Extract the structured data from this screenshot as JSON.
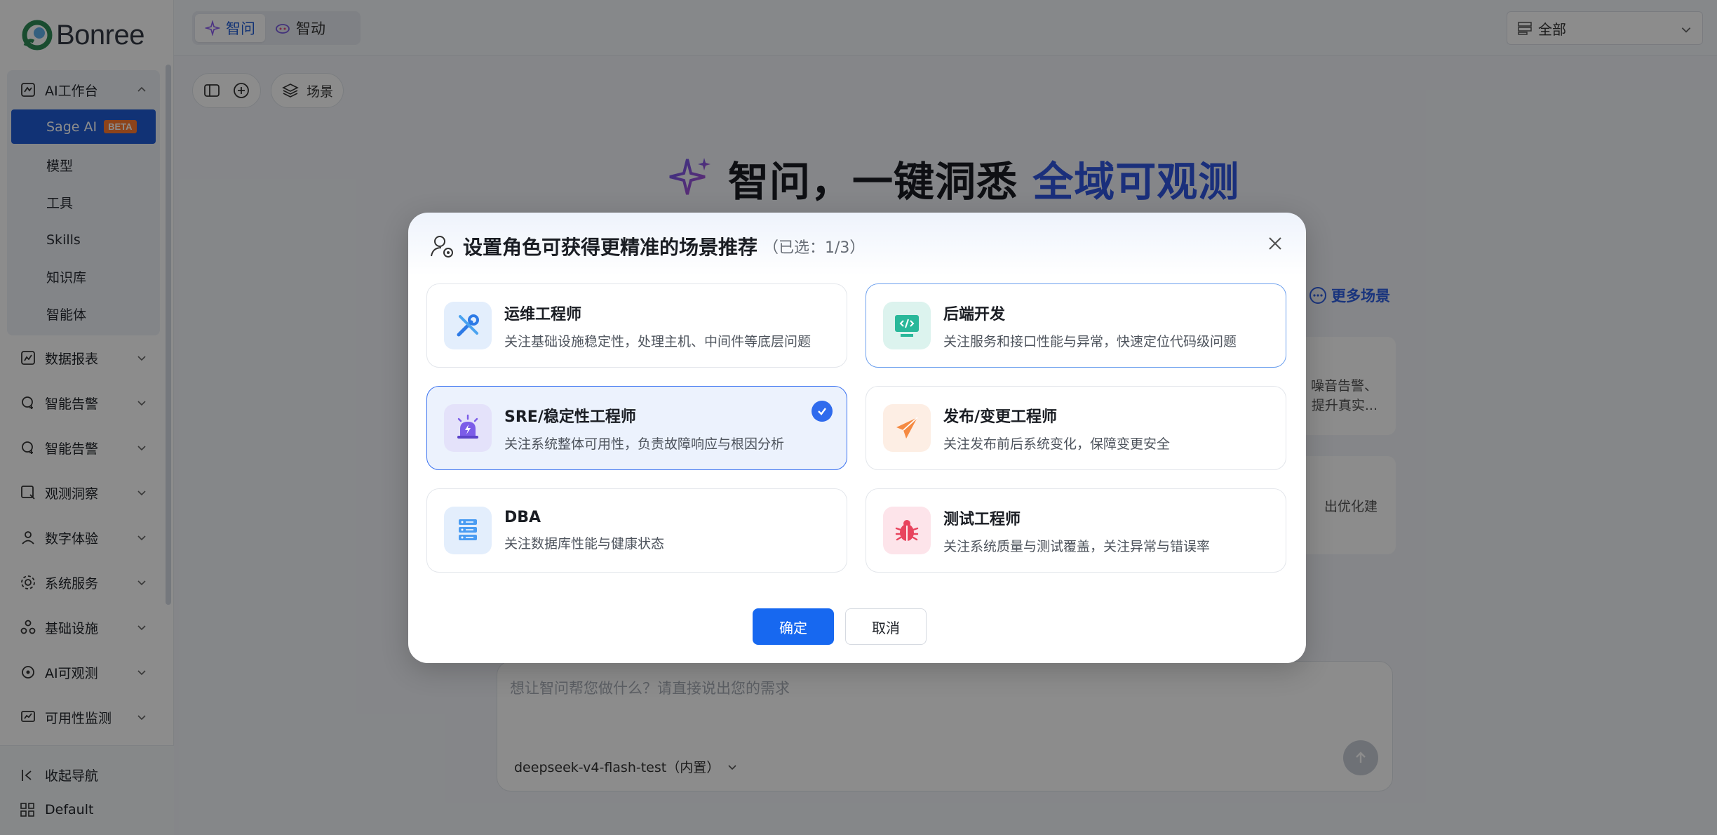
{
  "brand": {
    "name": "Bonree"
  },
  "sidebar": {
    "group": {
      "label": "AI工作台",
      "items": [
        {
          "label": "Sage AI",
          "badge": "BETA",
          "active": true
        },
        {
          "label": "模型"
        },
        {
          "label": "工具"
        },
        {
          "label": "Skills"
        },
        {
          "label": "知识库"
        },
        {
          "label": "智能体"
        }
      ]
    },
    "items": [
      {
        "label": "数据报表",
        "icon": "chart-icon"
      },
      {
        "label": "智能告警",
        "icon": "alert-icon"
      },
      {
        "label": "智能告警",
        "icon": "alert-icon"
      },
      {
        "label": "观测洞察",
        "icon": "insight-icon"
      },
      {
        "label": "数字体验",
        "icon": "user-icon"
      },
      {
        "label": "系统服务",
        "icon": "service-icon"
      },
      {
        "label": "基础设施",
        "icon": "infra-icon"
      },
      {
        "label": "AI可观测",
        "icon": "ai-icon"
      },
      {
        "label": "可用性监测",
        "icon": "monitor-icon"
      }
    ],
    "collapse_label": "收起导航",
    "workspace_label": "Default"
  },
  "topbar": {
    "tabs": [
      {
        "label": "智问",
        "active": true
      },
      {
        "label": "智动"
      }
    ],
    "scope": "全部"
  },
  "toolbar": {
    "scene_label": "场景"
  },
  "hero": {
    "title_main": "智问，一键洞悉 ",
    "title_accent": "全域可观测"
  },
  "background": {
    "more_scenes": "更多场景",
    "card1_line1": "噪音告警、",
    "card1_line2": "提升真实...",
    "card2_line1": "出优化建"
  },
  "input": {
    "placeholder": "想让智问帮您做什么？请直接说出您的需求",
    "model": "deepseek-v4-flash-test（内置）"
  },
  "dialog": {
    "title": "设置角色可获得更精准的场景推荐",
    "count": "（已选：1/3）",
    "roles": [
      {
        "name": "运维工程师",
        "desc": "关注基础设施稳定性，处理主机、中间件等底层问题",
        "icon": "wrench-screwdriver-icon"
      },
      {
        "name": "后端开发",
        "desc": "关注服务和接口性能与异常，快速定位代码级问题",
        "icon": "code-monitor-icon"
      },
      {
        "name": "SRE/稳定性工程师",
        "desc": "关注系统整体可用性，负责故障响应与根因分析",
        "icon": "alarm-siren-icon",
        "selected": true
      },
      {
        "name": "发布/变更工程师",
        "desc": "关注发布前后系统变化，保障变更安全",
        "icon": "paper-plane-icon"
      },
      {
        "name": "DBA",
        "desc": "关注数据库性能与健康状态",
        "icon": "database-icon"
      },
      {
        "name": "测试工程师",
        "desc": "关注系统质量与测试覆盖，关注异常与错误率",
        "icon": "bug-icon"
      }
    ],
    "ok_label": "确定",
    "cancel_label": "取消"
  },
  "colors": {
    "primary": "#1768f0",
    "accent": "#3157e0",
    "sidebar_active": "#1f5bd6",
    "beta": "#ff7a30"
  }
}
